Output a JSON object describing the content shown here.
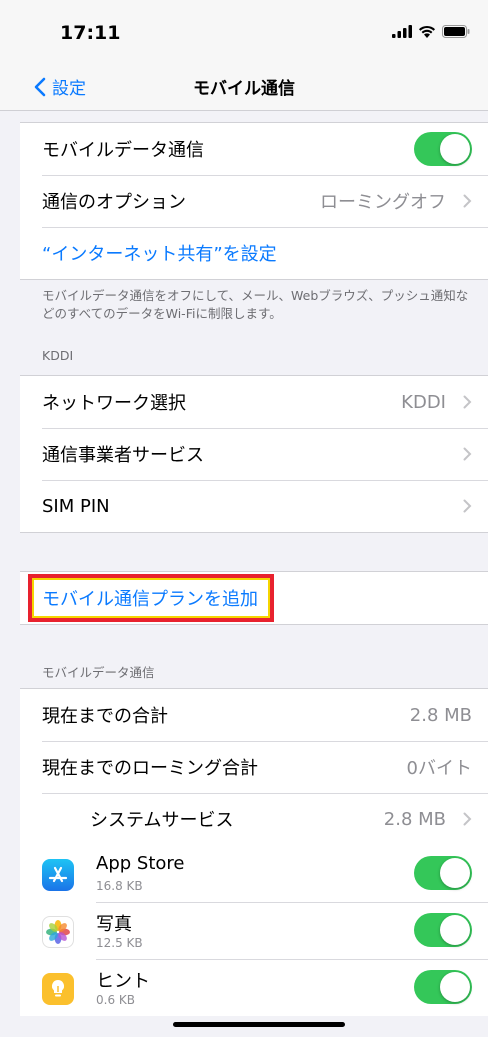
{
  "status_bar": {
    "time": "17:11"
  },
  "nav": {
    "back_label": "設定",
    "title": "モバイル通信"
  },
  "group1": {
    "cellular_data_label": "モバイルデータ通信",
    "options_label": "通信のオプション",
    "options_value": "ローミングオフ",
    "hotspot_label": "“インターネット共有”を設定"
  },
  "note1": "モバイルデータ通信をオフにして、メール、Webブラウズ、プッシュ通知などのすべてのデータをWi-Fiに制限します。",
  "carrier_header": "KDDI",
  "group2": {
    "network_label": "ネットワーク選択",
    "network_value": "KDDI",
    "carrier_services_label": "通信事業者サービス",
    "sim_pin_label": "SIM PIN"
  },
  "add_plan_label": "モバイル通信プランを追加",
  "usage_header": "モバイルデータ通信",
  "usage": {
    "total_label": "現在までの合計",
    "total_value": "2.8 MB",
    "roaming_label": "現在までのローミング合計",
    "roaming_value": "0バイト",
    "system_label": "システムサービス",
    "system_value": "2.8 MB"
  },
  "apps": [
    {
      "name": "App Store",
      "size": "16.8 KB",
      "icon": "app-store-icon",
      "enabled": true
    },
    {
      "name": "写真",
      "size": "12.5 KB",
      "icon": "photos-icon",
      "enabled": true
    },
    {
      "name": "ヒント",
      "size": "0.6 KB",
      "icon": "tips-icon",
      "enabled": true
    }
  ],
  "colors": {
    "accent": "#0a7aff",
    "toggle_on": "#34c759",
    "highlight": "#e8222e"
  }
}
